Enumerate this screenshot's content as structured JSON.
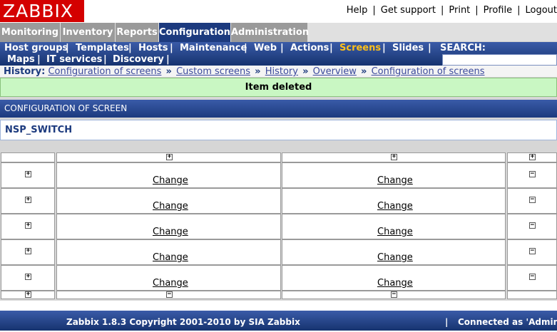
{
  "app": {
    "logo": "ZABBIX"
  },
  "toplinks": {
    "help": "Help",
    "support": "Get support",
    "print": "Print",
    "profile": "Profile",
    "logout": "Logout",
    "separator": "|"
  },
  "main_tabs": {
    "monitoring": "Monitoring",
    "inventory": "Inventory",
    "reports": "Reports",
    "configuration": "Configuration",
    "administration": "Administration",
    "active": "Configuration"
  },
  "submenu": {
    "host_groups": "Host groups",
    "templates": "Templates",
    "hosts": "Hosts",
    "maintenance": "Maintenance",
    "web": "Web",
    "actions": "Actions",
    "screens": "Screens",
    "slides": "Slides",
    "search_label": "SEARCH:",
    "maps": "Maps",
    "it_services": "IT services",
    "discovery": "Discovery",
    "separator": "|",
    "active": "Screens",
    "search_value": ""
  },
  "history": {
    "label": "History:",
    "arrow": "»",
    "items": [
      "Configuration of screens",
      "Custom screens",
      "History",
      "Overview",
      "Configuration of screens"
    ]
  },
  "message": {
    "text": "Item deleted"
  },
  "section": {
    "title": "CONFIGURATION OF SCREEN"
  },
  "screen": {
    "name": "NSP_SWITCH"
  },
  "grid": {
    "change_label": "Change",
    "add_symbol": "+",
    "remove_symbol": "−"
  },
  "footer": {
    "copyright": "Zabbix 1.8.3 Copyright 2001-2010 by SIA Zabbix",
    "separator": "|",
    "connected": "Connected as 'Admin'"
  },
  "colors": {
    "logo_bg": "#d40000",
    "nav_blue": "#1c3a7e",
    "active_submenu": "#ffc11a",
    "message_bg": "#c9f7c3"
  }
}
